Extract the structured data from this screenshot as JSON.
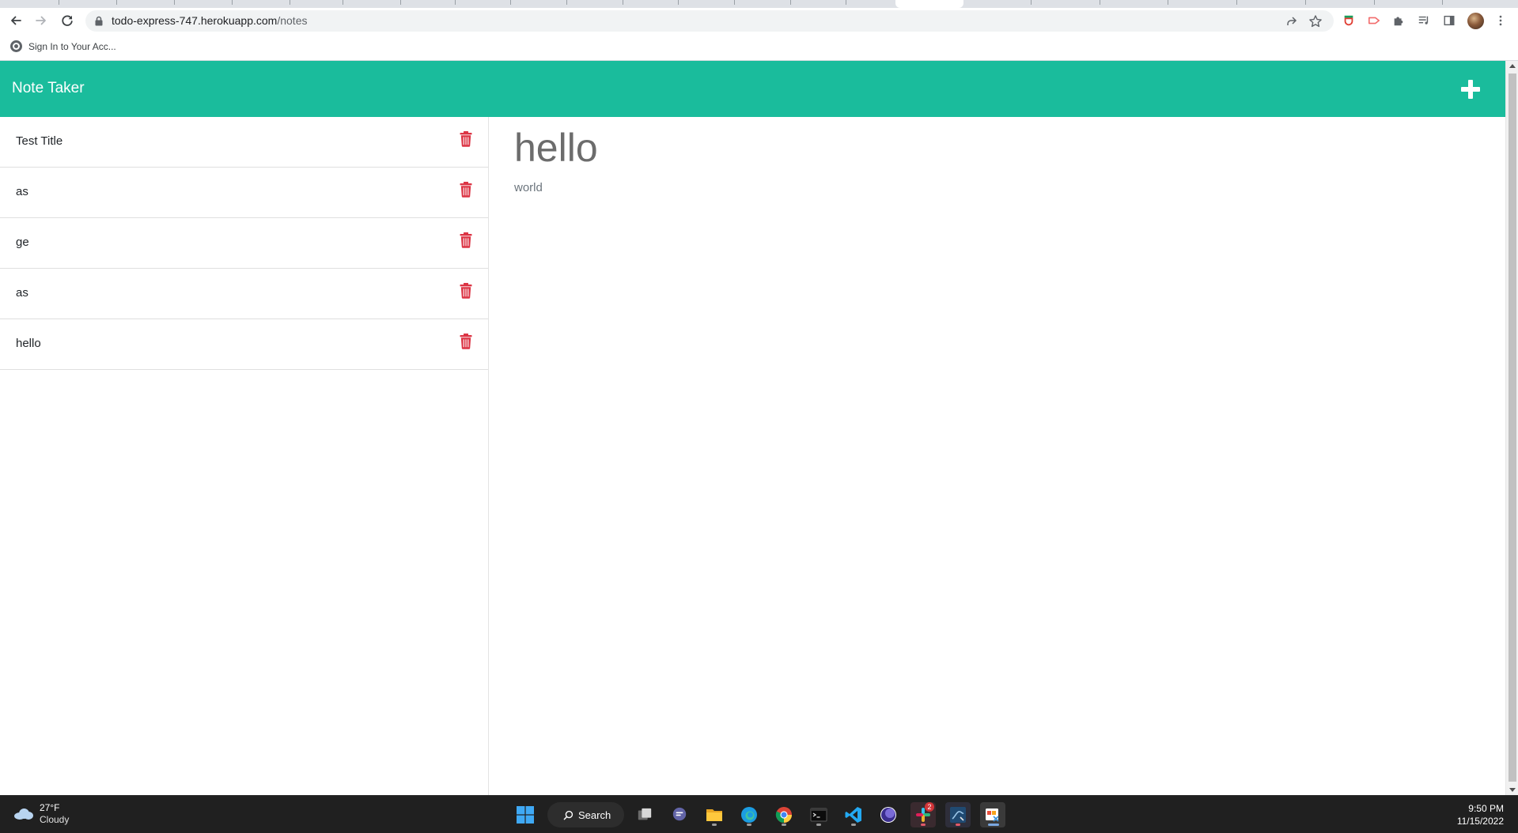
{
  "browser": {
    "url_host": "todo-express-747.herokuapp.com",
    "url_path": "/notes",
    "bookmark_label": "Sign In to Your Acc..."
  },
  "app": {
    "brand": "Note Taker",
    "accent_color": "#1abc9c",
    "delete_icon_color": "#dc3545"
  },
  "notes": [
    {
      "title": "Test Title"
    },
    {
      "title": "as"
    },
    {
      "title": "ge"
    },
    {
      "title": "as"
    },
    {
      "title": "hello"
    }
  ],
  "editor": {
    "title": "hello",
    "text": "world"
  },
  "taskbar": {
    "weather_temp": "27°F",
    "weather_cond": "Cloudy",
    "search_label": "Search",
    "slack_badge": "2",
    "time": "9:50 PM",
    "date": "11/15/2022"
  }
}
